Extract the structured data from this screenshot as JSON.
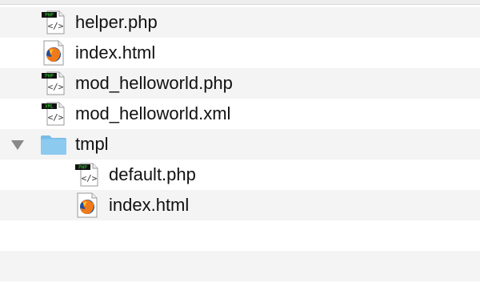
{
  "files": [
    {
      "name": "helper.php",
      "type": "php",
      "badge": "PHP",
      "level": 0
    },
    {
      "name": "index.html",
      "type": "html",
      "level": 0
    },
    {
      "name": "mod_helloworld.php",
      "type": "php",
      "badge": "PHP",
      "level": 0
    },
    {
      "name": "mod_helloworld.xml",
      "type": "xml",
      "badge": "XML",
      "level": 0
    },
    {
      "name": "tmpl",
      "type": "folder",
      "expanded": true,
      "level": 0
    },
    {
      "name": "default.php",
      "type": "php",
      "badge": "PHP",
      "level": 1
    },
    {
      "name": "index.html",
      "type": "html",
      "level": 1
    }
  ],
  "colors": {
    "row_alt": "#f4f4f4",
    "folder_blue": "#8ccaf0",
    "badge_bg": "#111111",
    "badge_text": "#2fd22f"
  },
  "icons": {
    "php": "php-file-icon",
    "xml": "xml-file-icon",
    "html": "firefox-html-file-icon",
    "folder": "folder-icon",
    "disclosure": "disclosure-triangle-expanded-icon"
  }
}
